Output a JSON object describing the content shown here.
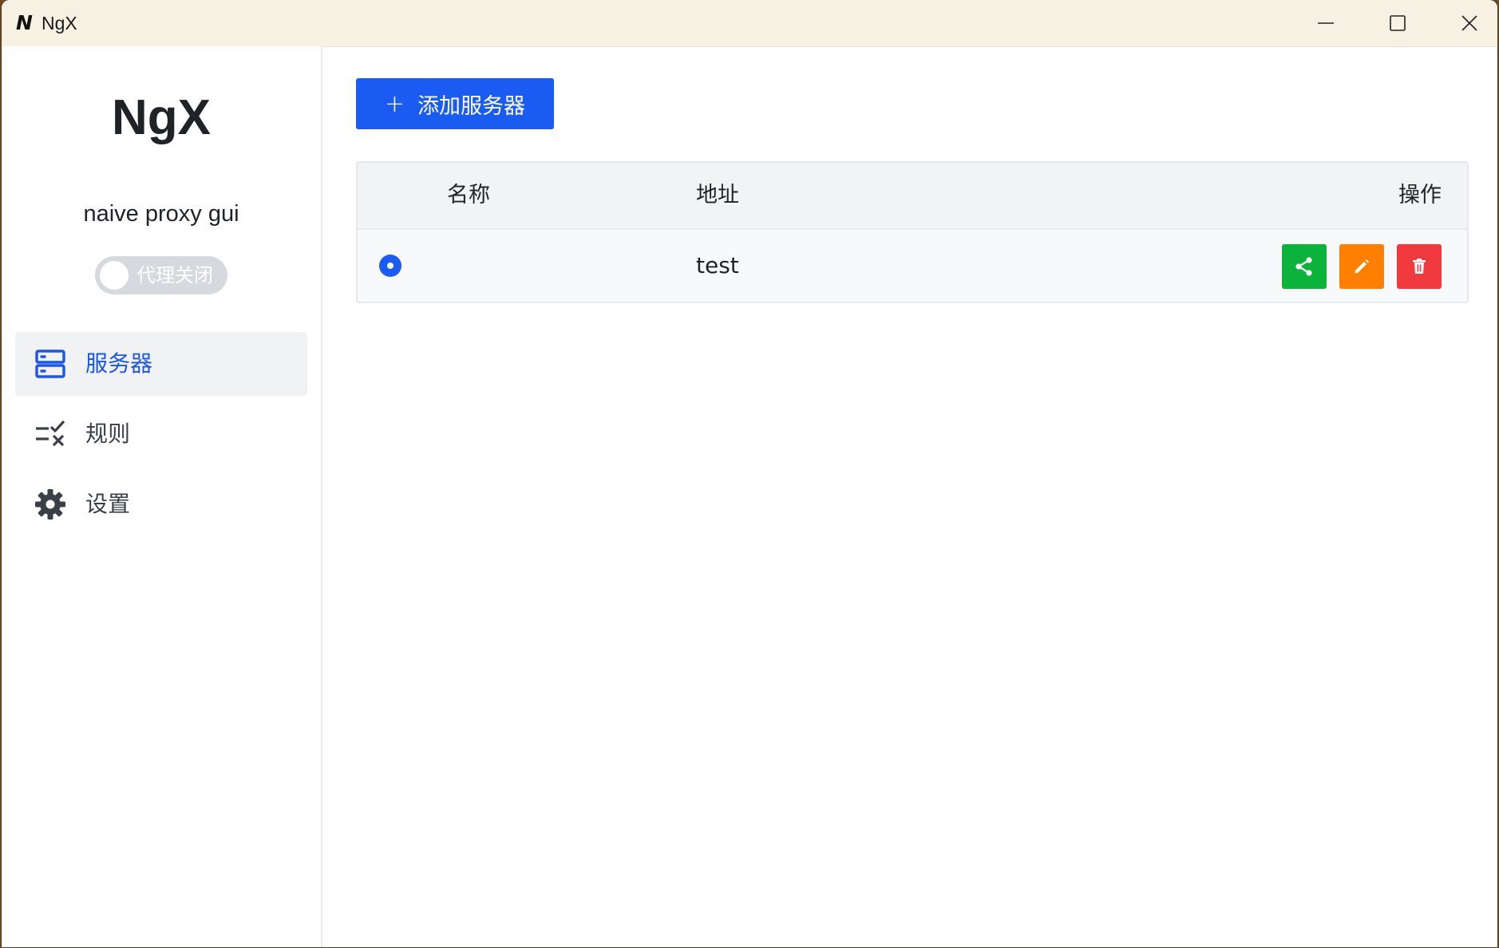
{
  "window": {
    "app_icon_letter": "N",
    "title": "NgX",
    "controls": [
      "minimize-icon",
      "maximize-icon",
      "close-icon"
    ]
  },
  "sidebar": {
    "logo": "NgX",
    "subtitle": "naive proxy gui",
    "proxy_toggle": {
      "label": "代理关闭",
      "on": false
    },
    "items": [
      {
        "label": "服务器",
        "icon": "server-icon",
        "active": true
      },
      {
        "label": "规则",
        "icon": "rules-icon",
        "active": false
      },
      {
        "label": "设置",
        "icon": "gear-icon",
        "active": false
      }
    ]
  },
  "main": {
    "add_button": {
      "icon": "+",
      "label": "添加服务器"
    },
    "table": {
      "columns": [
        "名称",
        "地址",
        "操作"
      ],
      "rows": [
        {
          "selected": true,
          "name": "",
          "address": "test"
        }
      ],
      "actions": [
        {
          "icon": "share-icon",
          "color": "#0bb33a"
        },
        {
          "icon": "edit-icon",
          "color": "#ff8000"
        },
        {
          "icon": "trash-icon",
          "color": "#f03a3e"
        }
      ]
    }
  },
  "colors": {
    "accent": "#1a5cf2",
    "titlebar": "#f7f1e3"
  }
}
